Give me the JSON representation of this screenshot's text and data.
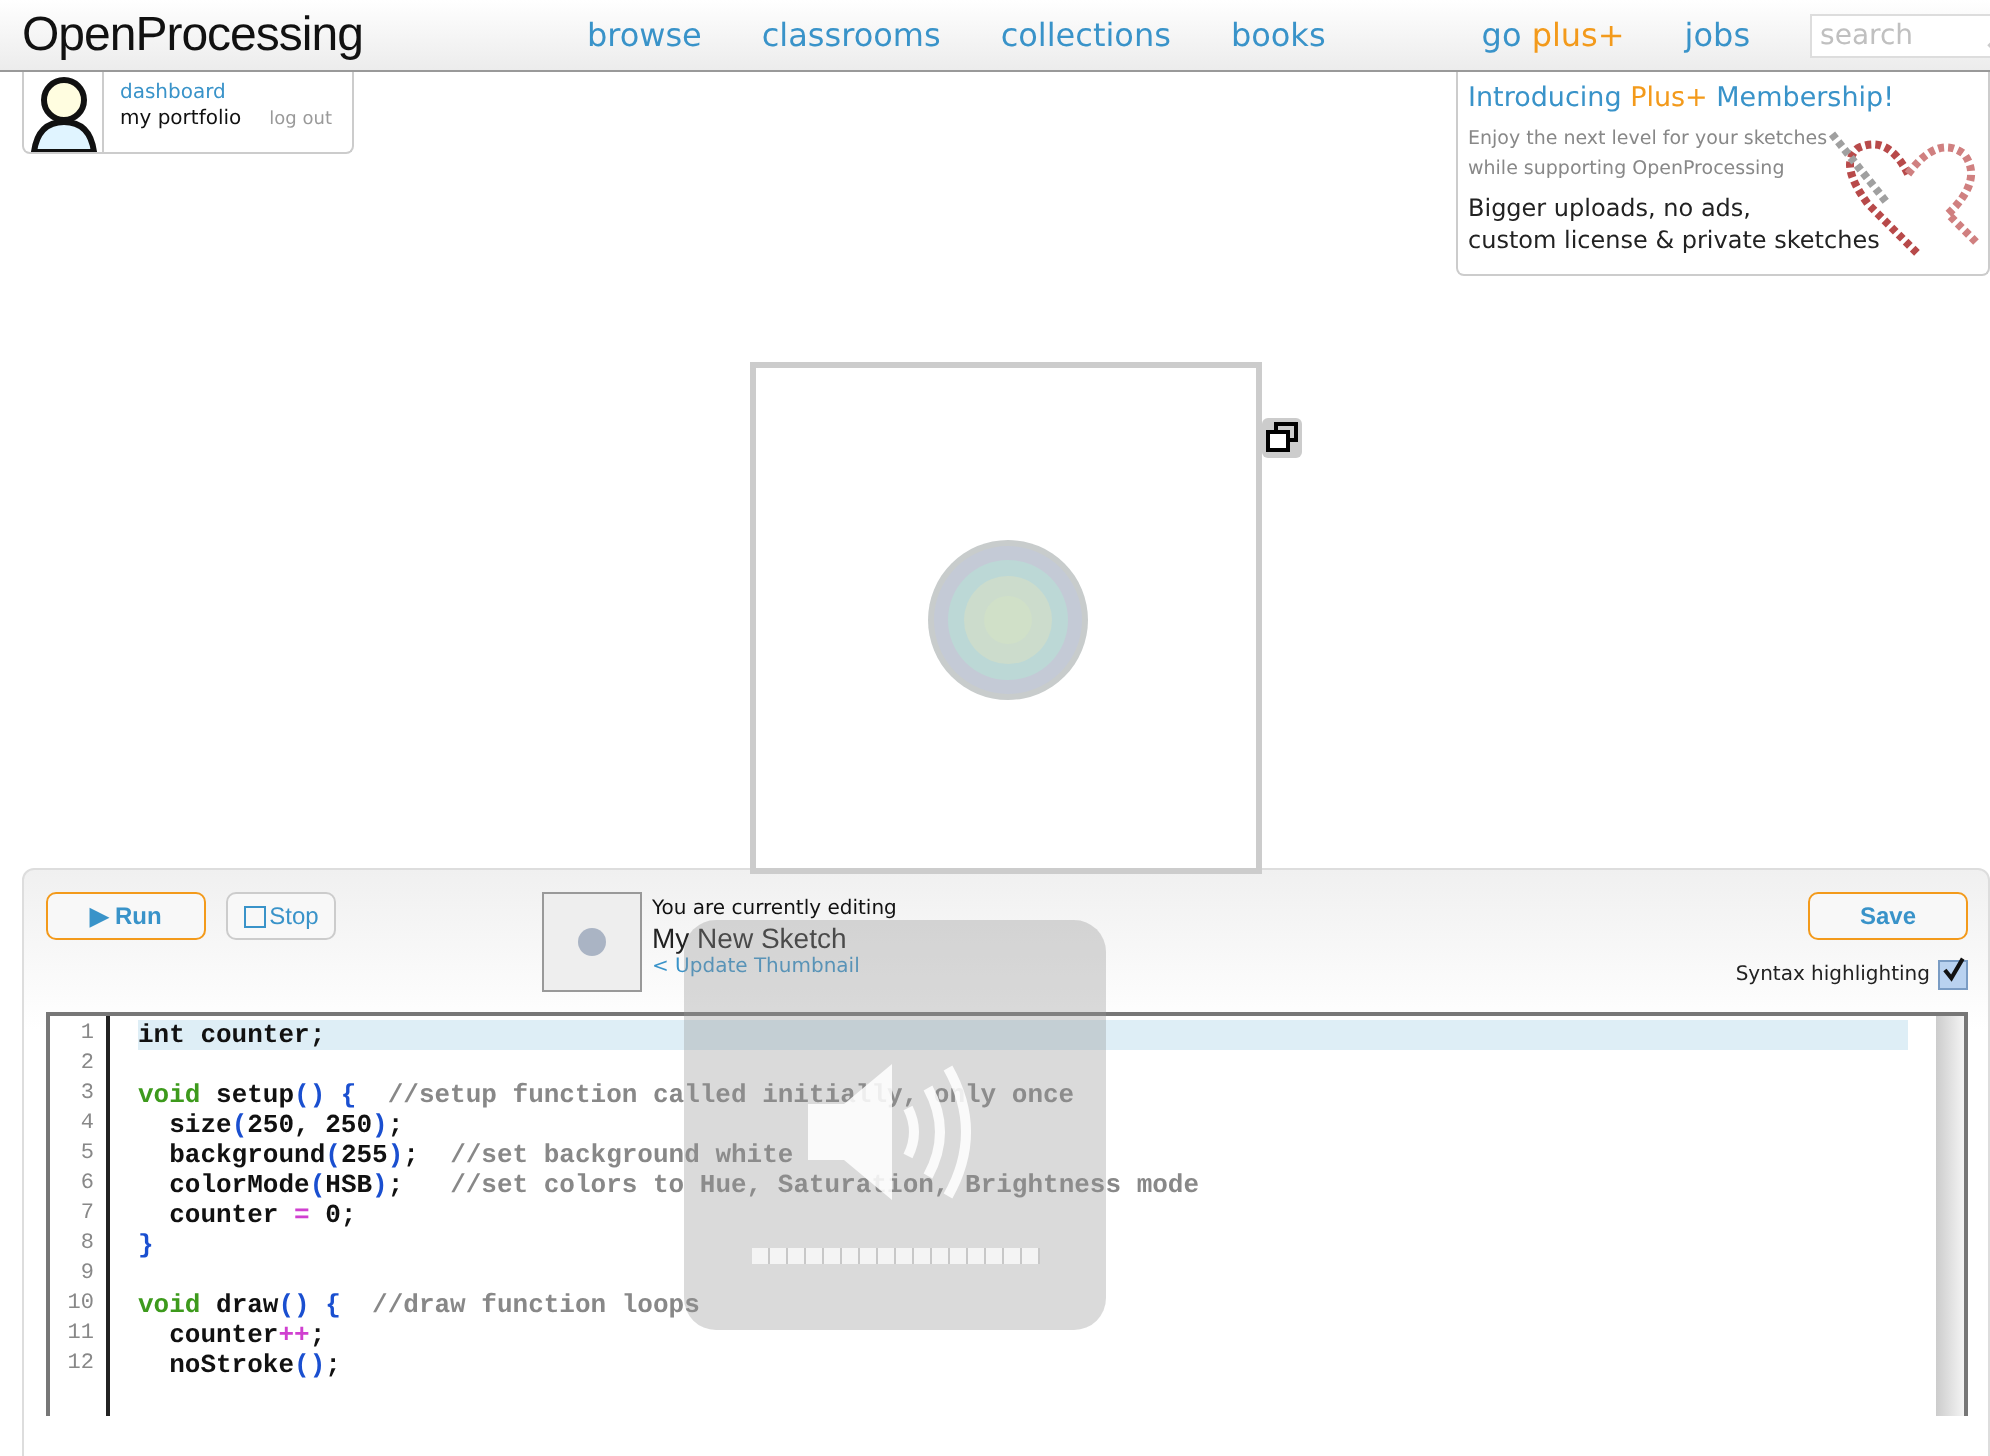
{
  "header": {
    "logo": "OpenProcessing",
    "nav": [
      {
        "label": "browse",
        "kind": "link"
      },
      {
        "label": "classrooms",
        "kind": "link"
      },
      {
        "label": "collections",
        "kind": "link"
      },
      {
        "label": "books",
        "kind": "link"
      },
      {
        "label": "go",
        "accent": "plus+",
        "kind": "plus"
      },
      {
        "label": "jobs",
        "kind": "link"
      }
    ],
    "search": {
      "placeholder": "search"
    }
  },
  "user_box": {
    "dashboard": "dashboard",
    "portfolio": "my portfolio",
    "logout": "log out"
  },
  "promo": {
    "title": "Introducing",
    "title_accent": "Plus+",
    "title_end": "Membership!",
    "blurb": [
      "Enjoy the next level for your sketches",
      "while supporting OpenProcessing"
    ],
    "features": [
      "Bigger uploads, no ads,",
      "custom license & private sketches"
    ]
  },
  "editor": {
    "run": "▶ Run",
    "stop": "Stop",
    "editing_label": "You are currently editing",
    "sketch_name": "My New Sketch",
    "update_thumbnail": "< Update Thumbnail",
    "save": "Save",
    "syntax_highlighting": {
      "label": "Syntax highlighting",
      "checked": true
    },
    "lines": [
      {
        "num": "1",
        "active": true,
        "tokens": [
          {
            "t": "int counter;",
            "kind": "plain"
          }
        ]
      },
      {
        "num": "2",
        "active": false
      },
      {
        "num": "3",
        "active": false,
        "tokens": [
          {
            "t": "void",
            "kind": "type"
          },
          {
            "t": " setup",
            "kind": "plain"
          },
          {
            "t": "() {",
            "kind": "paren"
          },
          {
            "t": "  //setup function called initially, only once",
            "kind": "comment"
          }
        ]
      },
      {
        "num": "4",
        "active": false,
        "tokens": [
          {
            "t": "  size",
            "kind": "plain"
          },
          {
            "t": "(",
            "kind": "paren"
          },
          {
            "t": "250, 250",
            "kind": "plain"
          },
          {
            "t": ")",
            "kind": "paren"
          },
          {
            "t": ";",
            "kind": "plain"
          }
        ]
      },
      {
        "num": "5",
        "active": false,
        "tokens": [
          {
            "t": "  background",
            "kind": "plain"
          },
          {
            "t": "(",
            "kind": "paren"
          },
          {
            "t": "255",
            "kind": "plain"
          },
          {
            "t": ")",
            "kind": "paren"
          },
          {
            "t": ";",
            "kind": "plain"
          },
          {
            "t": "  //set background white",
            "kind": "comment"
          }
        ]
      },
      {
        "num": "6",
        "active": false,
        "tokens": [
          {
            "t": "  colorMode",
            "kind": "plain"
          },
          {
            "t": "(",
            "kind": "paren"
          },
          {
            "t": "HSB",
            "kind": "plain"
          },
          {
            "t": ")",
            "kind": "paren"
          },
          {
            "t": ";",
            "kind": "plain"
          },
          {
            "t": "   //set colors to Hue, Saturation, Brightness mode",
            "kind": "comment"
          }
        ]
      },
      {
        "num": "7",
        "active": false,
        "tokens": [
          {
            "t": "  counter ",
            "kind": "plain"
          },
          {
            "t": "=",
            "kind": "op"
          },
          {
            "t": " 0;",
            "kind": "plain"
          }
        ]
      },
      {
        "num": "8",
        "active": false,
        "tokens": [
          {
            "t": "}",
            "kind": "paren"
          }
        ]
      },
      {
        "num": "9",
        "active": false
      },
      {
        "num": "10",
        "active": false,
        "tokens": [
          {
            "t": "void",
            "kind": "type"
          },
          {
            "t": " draw",
            "kind": "plain"
          },
          {
            "t": "() {",
            "kind": "paren"
          },
          {
            "t": "  //draw function loops",
            "kind": "comment"
          }
        ]
      },
      {
        "num": "11",
        "active": false,
        "tokens": [
          {
            "t": "  counter",
            "kind": "plain"
          },
          {
            "t": "++",
            "kind": "op"
          },
          {
            "t": ";",
            "kind": "plain"
          }
        ]
      },
      {
        "num": "12",
        "active": false,
        "tokens": [
          {
            "t": "  noStroke",
            "kind": "plain"
          },
          {
            "t": "()",
            "kind": "paren"
          },
          {
            "t": ";",
            "kind": "plain"
          }
        ]
      }
    ]
  },
  "volume_overlay": {
    "level": 1
  }
}
